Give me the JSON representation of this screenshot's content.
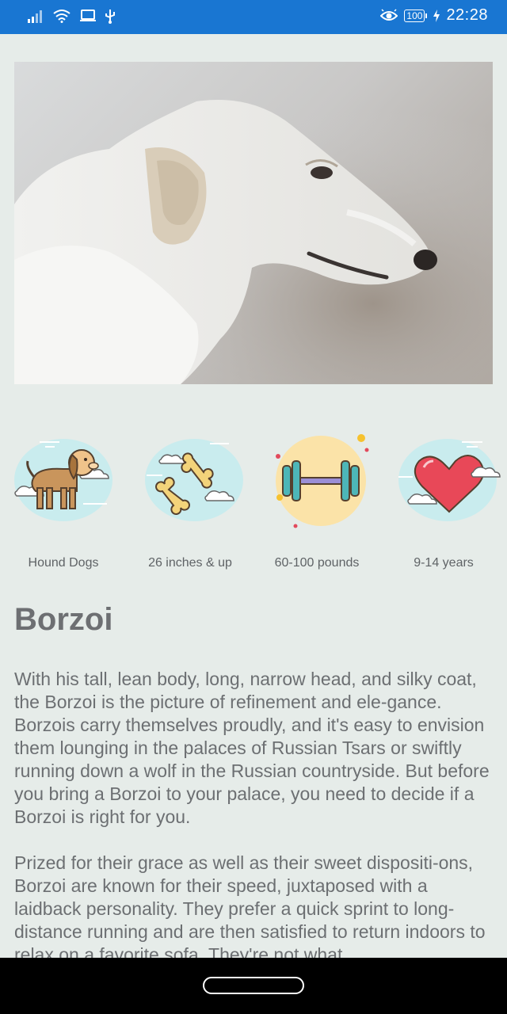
{
  "status_bar": {
    "time": "22:28",
    "battery_level": "100",
    "icons": [
      "signal-icon",
      "wifi-icon",
      "laptop-icon",
      "usb-icon",
      "eye-icon",
      "battery-icon",
      "charging-icon"
    ]
  },
  "hero": {
    "image": "borzoi-photo"
  },
  "info_items": [
    {
      "label": "Hound Dogs",
      "icon": "dog-icon"
    },
    {
      "label": "26 inches & up",
      "icon": "bones-icon"
    },
    {
      "label": "60-100 pounds",
      "icon": "dumbbell-icon"
    },
    {
      "label": "9-14 years",
      "icon": "heart-icon"
    }
  ],
  "breed": {
    "name": "Borzoi",
    "paragraphs": [
      "With his tall, lean body, long, narrow head, and silky coat, the Borzoi is the picture of refinement and ele-gance. Borzois carry themselves proudly, and it's easy to envision them lounging in the palaces of Russian Tsars or swiftly running down a wolf in the Russian countryside. But before you bring a Borzoi to your palace, you need to decide if a Borzoi is right for you.",
      "Prized for their grace as well as their sweet dispositi-ons, Borzoi are known for their speed, juxtaposed with a laidback personality. They prefer a quick sprint to long-distance running and are then satisfied to return indoors to relax on a favorite sofa. They're not what"
    ]
  },
  "colors": {
    "status_bar": "#1976d2",
    "background": "#e6ece9",
    "cloud": "#c9ecee",
    "text": "#6c6f72"
  }
}
